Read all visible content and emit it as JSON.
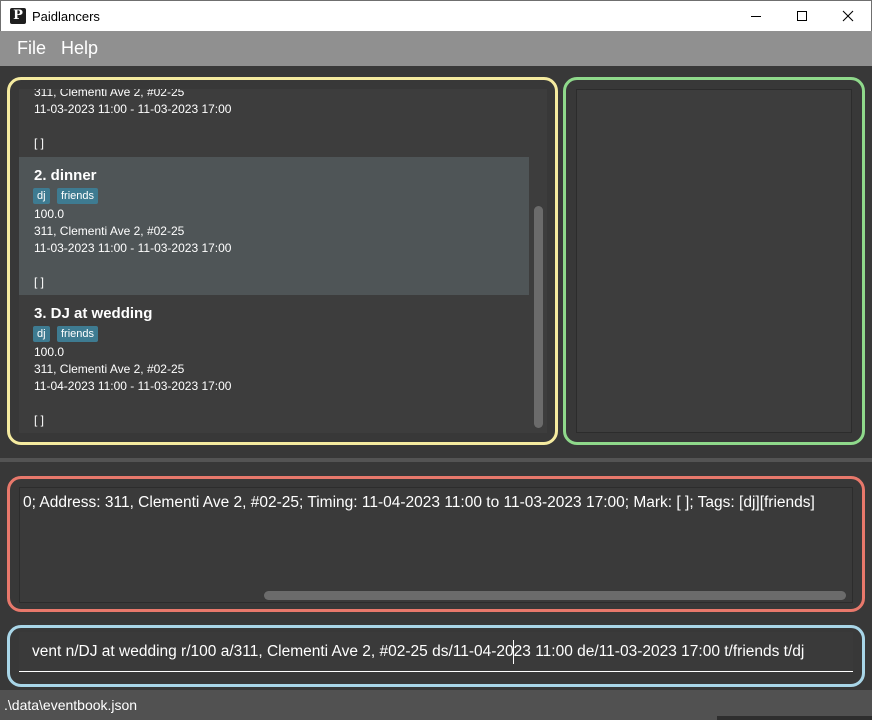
{
  "window": {
    "title": "Paidlancers",
    "icon_letter": "P"
  },
  "menu": {
    "file": "File",
    "help": "Help"
  },
  "event_list": {
    "partial_card": {
      "address": "311, Clementi Ave 2, #02-25",
      "timing": "11-03-2023 11:00 - 11-03-2023 17:00",
      "mark": "[ ]"
    },
    "cards": [
      {
        "title": "2.  dinner",
        "tags": [
          "dj",
          "friends"
        ],
        "rate": "100.0",
        "address": "311, Clementi Ave 2, #02-25",
        "timing": "11-03-2023 11:00 - 11-03-2023 17:00",
        "mark": "[ ]",
        "selected": true
      },
      {
        "title": "3.  DJ at wedding",
        "tags": [
          "dj",
          "friends"
        ],
        "rate": "100.0",
        "address": "311, Clementi Ave 2, #02-25",
        "timing": "11-04-2023 11:00 - 11-03-2023 17:00",
        "mark": "[ ]",
        "selected": false
      }
    ]
  },
  "result_display": {
    "text": "0; Address: 311, Clementi Ave 2, #02-25; Timing: 11-04-2023 11:00 to 11-03-2023 17:00; Mark: [ ]; Tags: [dj][friends]"
  },
  "command_box": {
    "value": "vent n/DJ at wedding r/100 a/311, Clementi Ave 2, #02-25 ds/11-04-2023 11:00 de/11-03-2023 17:00 t/friends t/dj"
  },
  "status_bar": {
    "path": ".\\data\\eventbook.json"
  },
  "colors": {
    "list_outline": "#f5eba0",
    "detail_outline": "#8fd98b",
    "result_outline": "#e8786b",
    "command_outline": "#a9d6e8",
    "tag_bg": "#3e7b91",
    "selected_card": "#4f5557"
  }
}
